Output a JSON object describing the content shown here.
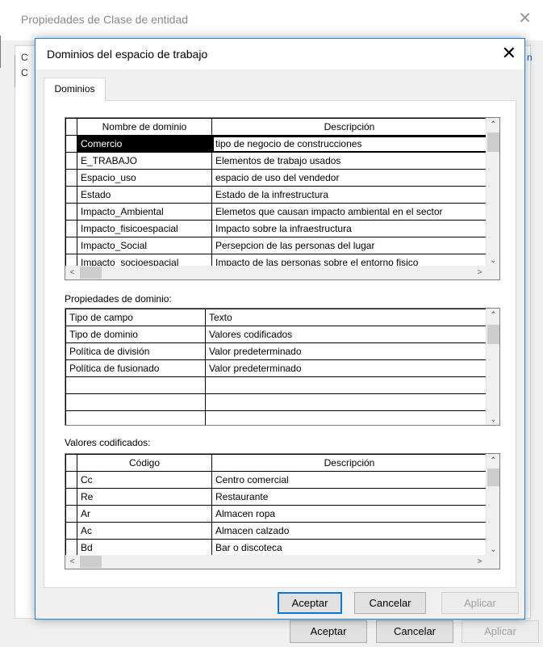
{
  "background_window": {
    "title": "Propiedades de Clase de entidad",
    "close_icon": "close-icon",
    "tab_fragment_1": "C",
    "tab_fragment_2": "C",
    "right_fragment": "n",
    "buttons": {
      "ok": "Aceptar",
      "cancel": "Cancelar",
      "apply": "Aplicar"
    }
  },
  "dialog": {
    "title": "Dominios del espacio de trabajo",
    "close_glyph": "✕",
    "tab": "Dominios",
    "domains": {
      "headers": [
        "Nombre de dominio",
        "Descripción"
      ],
      "selected_index": 0,
      "rows": [
        [
          "Comercio",
          "tipo de negocio de construcciones"
        ],
        [
          "E_TRABAJO",
          "Elementos de trabajo usados"
        ],
        [
          "Espacio_uso",
          "espacio de uso del vendedor"
        ],
        [
          "Estado",
          "Estado de la infrestructura"
        ],
        [
          "Impacto_Ambiental",
          "Elemetos que causan impacto ambiental en el sector"
        ],
        [
          "Impacto_fisicoespacial",
          "Impacto sobre la infraestructura"
        ],
        [
          "Impacto_Social",
          "Persepcion de las personas del lugar"
        ],
        [
          "Impacto_socioespacial",
          "Impacto de las personas sobre el entorno fisico"
        ]
      ]
    },
    "domain_properties": {
      "label": "Propiedades de dominio:",
      "rows": [
        [
          "Tipo de campo",
          "Texto"
        ],
        [
          "Tipo de dominio",
          "Valores codificados"
        ],
        [
          "Política de división",
          "Valor predeterminado"
        ],
        [
          "Política de fusionado",
          "Valor predeterminado"
        ],
        [
          "",
          ""
        ],
        [
          "",
          ""
        ],
        [
          "",
          ""
        ]
      ]
    },
    "coded_values": {
      "label": "Valores codificados:",
      "headers": [
        "Código",
        "Descripción"
      ],
      "rows": [
        [
          "Cc",
          "Centro comercial"
        ],
        [
          "Re",
          "Restaurante"
        ],
        [
          "Ar",
          "Almacen ropa"
        ],
        [
          "Ac",
          "Almacen calzado"
        ],
        [
          "Bd",
          "Bar o discoteca"
        ]
      ]
    },
    "buttons": {
      "ok": "Aceptar",
      "cancel": "Cancelar",
      "apply": "Aplicar"
    }
  },
  "scroll_glyphs": {
    "up": "⌃",
    "down": "⌄",
    "left": "<",
    "right": ">"
  }
}
